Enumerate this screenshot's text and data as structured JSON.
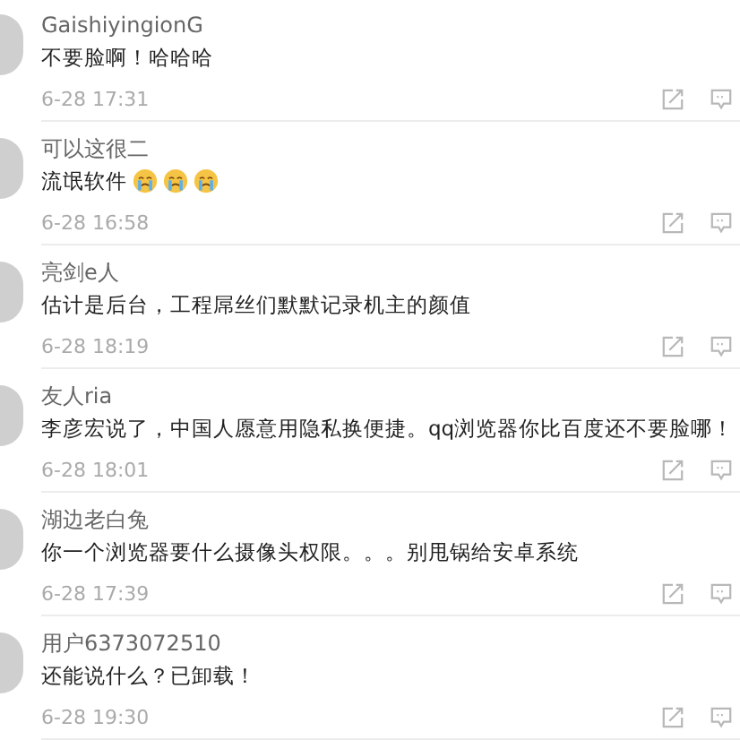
{
  "comments": [
    {
      "user": "GaishiyingionG",
      "text": "不要脸啊！哈哈哈",
      "time": "6-28 17:31"
    },
    {
      "user": "可以这很二",
      "text": "流氓软件",
      "emojis": [
        {
          "kind": "crying"
        },
        {
          "kind": "crying"
        },
        {
          "kind": "crying"
        }
      ],
      "time": "6-28 16:58"
    },
    {
      "user": "亮剑e人",
      "text": "估计是后台，工程屌丝们默默记录机主的颜值",
      "time": "6-28 18:19"
    },
    {
      "user": "友人ria",
      "text": "李彦宏说了，中国人愿意用隐私换便捷。qq浏览器你比百度还不要脸哪！",
      "time": "6-28 18:01"
    },
    {
      "user": "湖边老白兔",
      "text": "你一个浏览器要什么摄像头权限。。。别甩锅给安卓系统",
      "time": "6-28 17:39"
    },
    {
      "user": "用户6373072510",
      "text": "还能说什么？已卸载！",
      "time": "6-28 19:30"
    }
  ]
}
